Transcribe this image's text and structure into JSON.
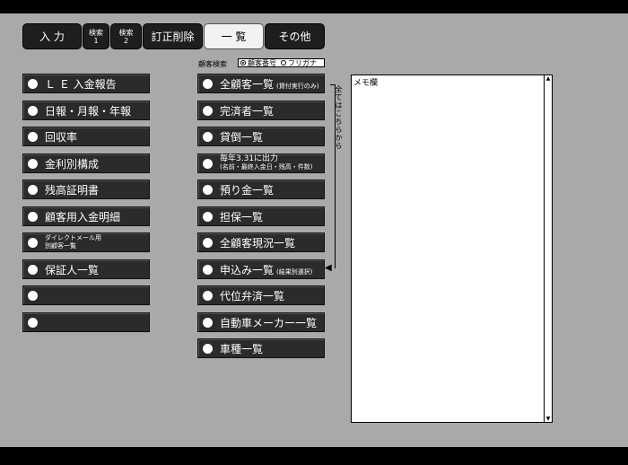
{
  "tabs": {
    "input": "入 力",
    "search1": "検索\n1",
    "search2": "検索\n2",
    "correction_delete": "訂正削除",
    "list": "一 覧",
    "other": "その他"
  },
  "search": {
    "label": "顧客検索",
    "option_customer_no": "顧客番号",
    "option_furigana": "フリガナ",
    "selected": "顧客番号"
  },
  "left_menu": {
    "le_report": "Ｌ Ｅ 入金報告",
    "daily_monthly_yearly": "日報・月報・年報",
    "collection_rate": "回収率",
    "interest_composition": "金利別構成",
    "balance_certificate": "残高証明書",
    "customer_payment_details": "顧客用入金明細",
    "direct_mail_line1": "ダイレクトメール用",
    "direct_mail_line2": "別顧客一覧",
    "guarantor_list": "保証人一覧",
    "blank1": "",
    "blank2": ""
  },
  "mid_menu": {
    "all_customers": "全顧客一覧",
    "all_customers_note": "(貸付実行のみ)",
    "completed_list": "完済者一覧",
    "bad_debt_list": "貸倒一覧",
    "annual_output_line1": "毎年3.31に出力",
    "annual_output_line2": "(名前・最終入金日・残高・件数)",
    "deposit_list": "預り金一覧",
    "collateral_list": "担保一覧",
    "all_customers_status": "全顧客現況一覧",
    "application_list": "申込み一覧",
    "application_note": "(結果別選択)",
    "subrogation_list": "代位弁済一覧",
    "car_maker_list": "自動車メーカー一覧",
    "car_model_list": "車種一覧"
  },
  "bracket_note": "全てはこちらから",
  "memo": {
    "label": "メモ欄"
  }
}
